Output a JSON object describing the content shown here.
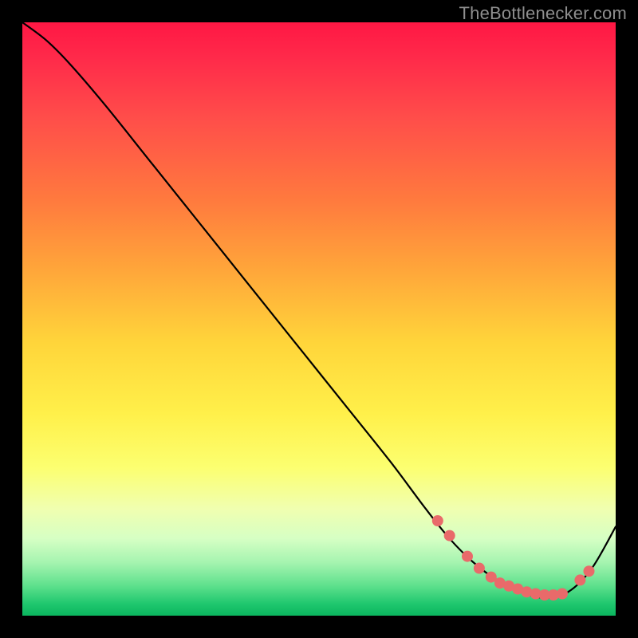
{
  "attribution": "TheBottlenecker.com",
  "colors": {
    "frame_bg": "#000000",
    "attribution_text": "#8e8e8e",
    "curve_stroke": "#000000",
    "marker_fill": "#e96a6a",
    "gradient_stops": [
      "#ff1744",
      "#ff2a4a",
      "#ff4d4a",
      "#ff7a3e",
      "#ffa73a",
      "#ffd53a",
      "#fff04a",
      "#fcff70",
      "#f0ffb0",
      "#d6ffc4",
      "#a6f4b0",
      "#5de08c",
      "#1fc76e",
      "#0bb65f"
    ]
  },
  "chart_data": {
    "type": "line",
    "title": "",
    "xlabel": "",
    "ylabel": "",
    "xlim": [
      0,
      100
    ],
    "ylim": [
      0,
      100
    ],
    "grid": false,
    "legend": false,
    "series": [
      {
        "name": "curve",
        "x": [
          0,
          4,
          8,
          14,
          22,
          30,
          38,
          46,
          54,
          62,
          68,
          72,
          76,
          80,
          84,
          88,
          92,
          96,
          100
        ],
        "y": [
          100,
          97,
          93,
          86,
          76,
          66,
          56,
          46,
          36,
          26,
          18,
          13,
          9,
          6,
          4,
          3,
          4,
          8,
          15
        ]
      }
    ],
    "markers": {
      "name": "highlighted-points",
      "x": [
        70,
        72,
        75,
        77,
        79,
        80.5,
        82,
        83.5,
        85,
        86.5,
        88,
        89.5,
        91,
        94,
        95.5
      ],
      "y": [
        16,
        13.5,
        10,
        8,
        6.5,
        5.5,
        5,
        4.5,
        4,
        3.7,
        3.5,
        3.5,
        3.7,
        6,
        7.5
      ]
    }
  }
}
